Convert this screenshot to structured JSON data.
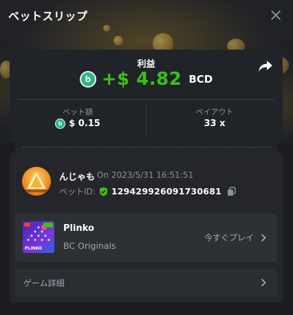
{
  "header": {
    "title": "ベットスリップ"
  },
  "profit": {
    "label": "利益",
    "amount": "+$ 4.82",
    "currency": "BCD",
    "coin_symbol": "b"
  },
  "stats": {
    "bet_amount_label": "ベット額",
    "bet_amount_value": "$ 0.15",
    "payout_label": "ペイアウト",
    "payout_value": "33 x"
  },
  "user": {
    "name": "んじゃも",
    "datetime": "On 2023/5/31 16:51:51",
    "bet_id_label": "ベットID:",
    "bet_id": "129429926091730681"
  },
  "game": {
    "name": "Plinko",
    "provider": "BC Originals",
    "play_now": "今すぐプレイ",
    "thumb_text": "PLINKO"
  },
  "details": {
    "label": "ゲーム詳細"
  },
  "colors": {
    "accent_green": "#3bc117",
    "bcd_green": "#2bb686",
    "background": "#1a1c20",
    "card": "#24262b"
  },
  "icons": [
    "close-icon",
    "share-icon",
    "bcd-coin-icon",
    "shield-check-icon",
    "copy-icon",
    "chevron-right-icon"
  ]
}
